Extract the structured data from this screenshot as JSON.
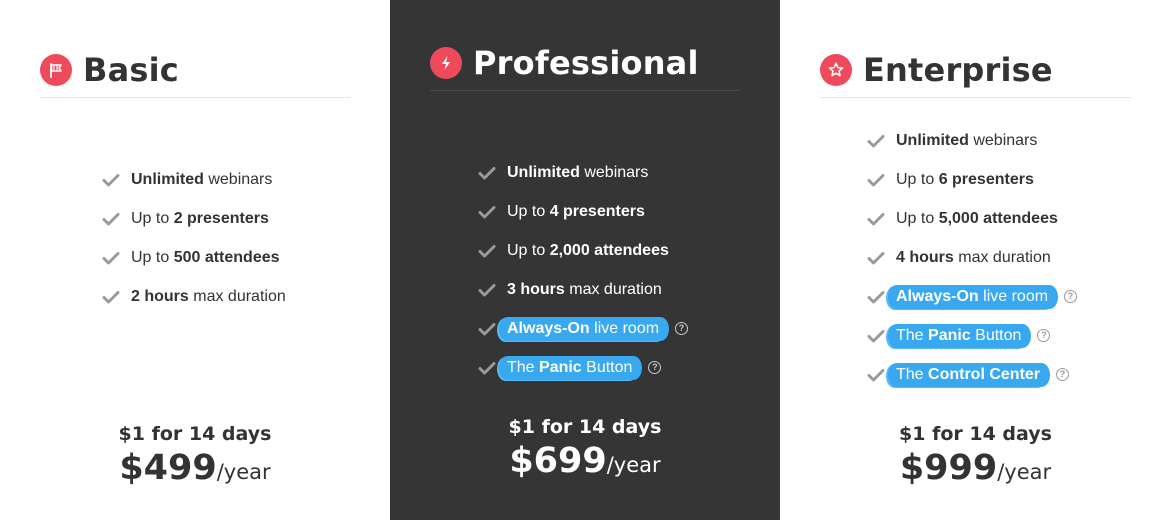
{
  "colors": {
    "accent": "#ef4a5c",
    "highlight": "#38a8f0",
    "featured_bg": "#353535",
    "check": "#9a9a9a"
  },
  "plans": [
    {
      "title": "Basic",
      "icon": "flag-icon",
      "featured": false,
      "features": [
        {
          "bold": "Unlimited",
          "text": " webinars",
          "highlight": false,
          "help": false
        },
        {
          "pre": "Up to ",
          "bold": "2 presenters",
          "highlight": false,
          "help": false
        },
        {
          "pre": "Up to ",
          "bold": "500 attendees",
          "highlight": false,
          "help": false
        },
        {
          "bold": "2 hours",
          "text": " max duration",
          "highlight": false,
          "help": false
        }
      ],
      "trial": "$1 for 14 days",
      "price": "$499",
      "period": "/year"
    },
    {
      "title": "Professional",
      "icon": "lightning-icon",
      "featured": true,
      "features": [
        {
          "bold": "Unlimited",
          "text": " webinars",
          "highlight": false,
          "help": false
        },
        {
          "pre": "Up to ",
          "bold": "4 presenters",
          "highlight": false,
          "help": false
        },
        {
          "pre": "Up to ",
          "bold": "2,000 attendees",
          "highlight": false,
          "help": false
        },
        {
          "bold": "3 hours",
          "text": " max duration",
          "highlight": false,
          "help": false
        },
        {
          "bold": "Always-On",
          "text": " live room",
          "highlight": true,
          "help": true
        },
        {
          "pre": "The ",
          "bold": "Panic",
          "text": " Button",
          "highlight": true,
          "help": true
        }
      ],
      "trial": "$1 for 14 days",
      "price": "$699",
      "period": "/year"
    },
    {
      "title": "Enterprise",
      "icon": "star-icon",
      "featured": false,
      "features": [
        {
          "bold": "Unlimited",
          "text": " webinars",
          "highlight": false,
          "help": false
        },
        {
          "pre": "Up to ",
          "bold": "6 presenters",
          "highlight": false,
          "help": false
        },
        {
          "pre": "Up to ",
          "bold": "5,000 attendees",
          "highlight": false,
          "help": false
        },
        {
          "bold": "4 hours",
          "text": " max duration",
          "highlight": false,
          "help": false
        },
        {
          "bold": "Always-On",
          "text": " live room",
          "highlight": true,
          "help": true
        },
        {
          "pre": "The ",
          "bold": "Panic",
          "text": " Button",
          "highlight": true,
          "help": true
        },
        {
          "pre": "The ",
          "bold": "Control Center",
          "highlight": true,
          "help": true
        }
      ],
      "trial": "$1 for 14 days",
      "price": "$999",
      "period": "/year"
    }
  ]
}
